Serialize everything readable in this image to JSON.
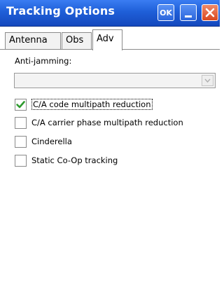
{
  "window": {
    "title": "Tracking Options",
    "ok_label": "OK",
    "buttons": [
      "ok-button",
      "minimize-button",
      "close-button"
    ]
  },
  "tabs": [
    {
      "label": "Antenna",
      "active": false
    },
    {
      "label": "Obs",
      "active": false
    },
    {
      "label": "Adv",
      "active": true
    }
  ],
  "anti_jamming": {
    "label": "Anti-jamming:",
    "value": "",
    "enabled": false
  },
  "options": [
    {
      "label": "C/A code multipath reduction",
      "checked": true
    },
    {
      "label": "C/A carrier phase multipath reduction",
      "checked": false
    },
    {
      "label": "Cinderella",
      "checked": false
    },
    {
      "label": "Static Co-Op tracking",
      "checked": false
    }
  ],
  "colors": {
    "titlebar": "#1f5fd8",
    "close_button": "#d9481f",
    "checkmark": "#2e9a2e"
  },
  "icons": [
    "close-icon",
    "minimize-icon",
    "dropdown-arrow-icon",
    "checkmark-icon"
  ]
}
